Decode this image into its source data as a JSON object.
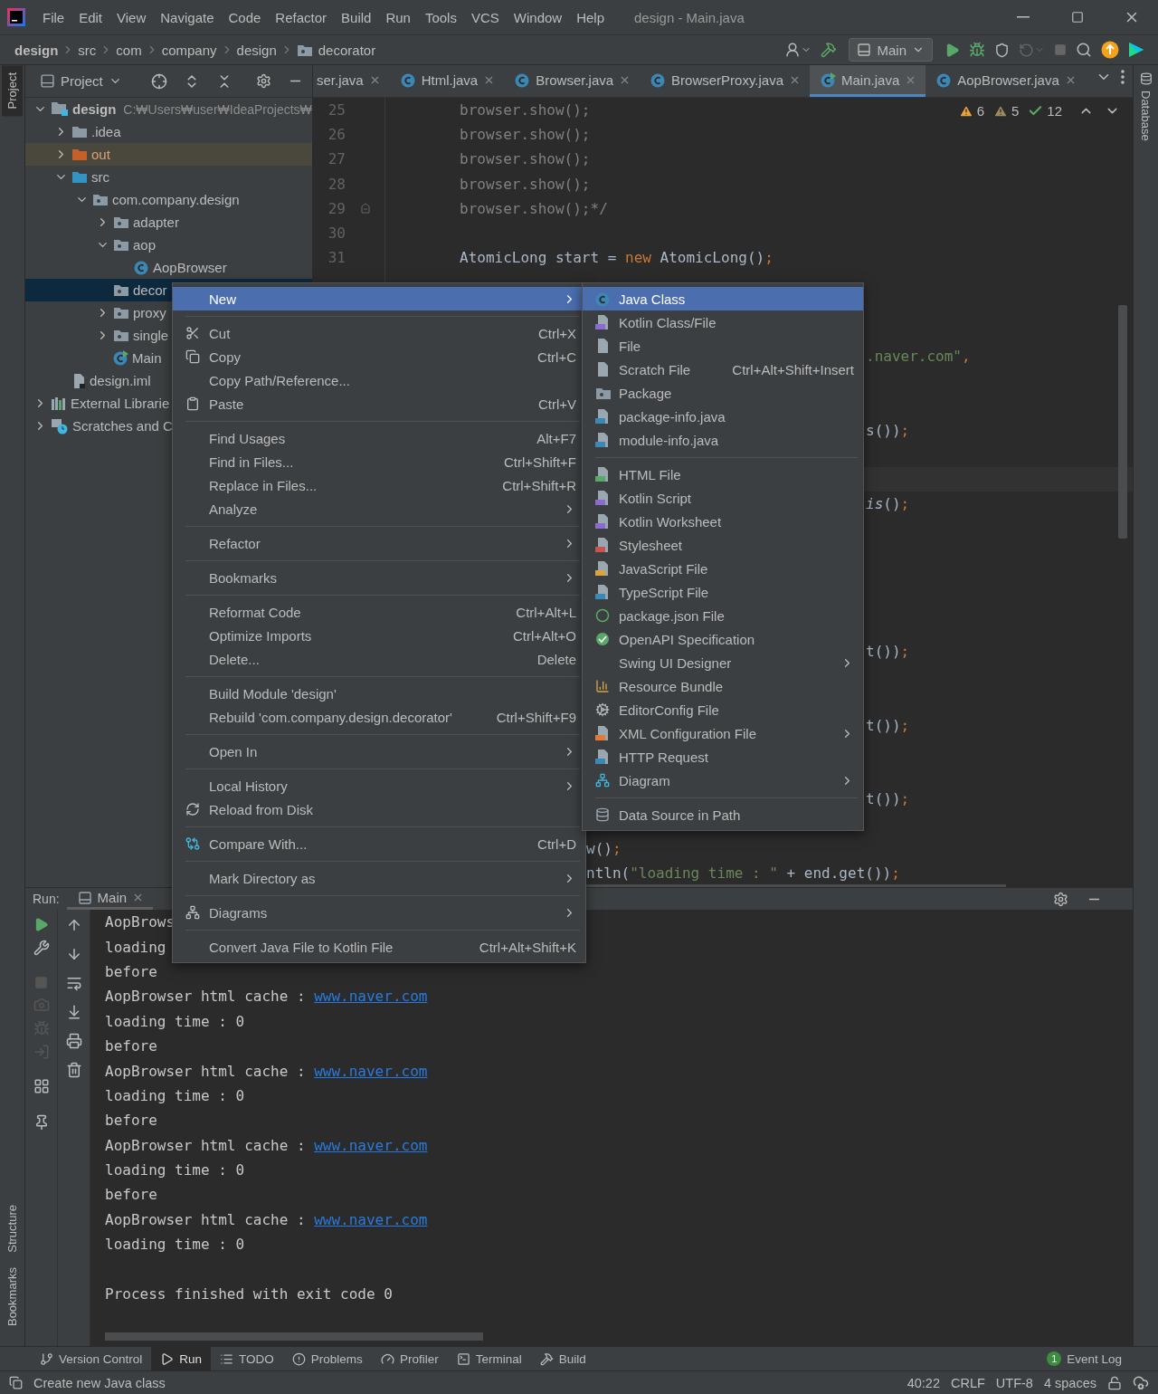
{
  "window": {
    "title": "design - Main.java",
    "menu": [
      "File",
      "Edit",
      "View",
      "Navigate",
      "Code",
      "Refactor",
      "Build",
      "Run",
      "Tools",
      "VCS",
      "Window",
      "Help"
    ]
  },
  "breadcrumbs": [
    "design",
    "src",
    "com",
    "company",
    "design",
    "decorator"
  ],
  "run_config": "Main",
  "left_strip": [
    {
      "label": "Project",
      "selected": true
    },
    {
      "label": "Structure",
      "selected": false
    },
    {
      "label": "Bookmarks",
      "selected": false
    }
  ],
  "right_strip": [
    {
      "label": "Database",
      "selected": false
    }
  ],
  "project_panel": {
    "title": "Project",
    "tree": [
      {
        "label": "design",
        "path": "C:₩Users₩user₩IdeaProjects₩",
        "kind": "module",
        "expanded": true,
        "selected": false,
        "children": [
          {
            "label": ".idea",
            "kind": "folder",
            "expanded": false,
            "selected": false
          },
          {
            "label": "out",
            "kind": "excluded",
            "expanded": false,
            "selected": false
          },
          {
            "label": "src",
            "kind": "source",
            "expanded": true,
            "selected": false,
            "children": [
              {
                "label": "com.company.design",
                "kind": "package",
                "expanded": true,
                "selected": false,
                "children": [
                  {
                    "label": "adapter",
                    "kind": "package",
                    "expanded": false,
                    "selected": false
                  },
                  {
                    "label": "aop",
                    "kind": "package",
                    "expanded": true,
                    "selected": false,
                    "children": [
                      {
                        "label": "AopBrowser",
                        "kind": "class",
                        "selected": false
                      }
                    ]
                  },
                  {
                    "label": "decor",
                    "kind": "package",
                    "selected": true
                  },
                  {
                    "label": "proxy",
                    "kind": "package",
                    "expanded": false,
                    "selected": false
                  },
                  {
                    "label": "single",
                    "kind": "package",
                    "expanded": false,
                    "selected": false
                  },
                  {
                    "label": "Main",
                    "kind": "main_class",
                    "selected": false
                  }
                ]
              }
            ]
          },
          {
            "label": "design.iml",
            "kind": "iml",
            "selected": false
          }
        ]
      },
      {
        "label": "External Librarie",
        "kind": "libraries",
        "expanded": false,
        "selected": false
      },
      {
        "label": "Scratches and C",
        "kind": "scratches",
        "expanded": false,
        "selected": false
      }
    ]
  },
  "tabs": [
    {
      "label": "ser.java",
      "kind": "partial",
      "selected": false
    },
    {
      "label": "Html.java",
      "kind": "class",
      "selected": false
    },
    {
      "label": "Browser.java",
      "kind": "class",
      "selected": false
    },
    {
      "label": "BrowserProxy.java",
      "kind": "class",
      "selected": false
    },
    {
      "label": "Main.java",
      "kind": "main_class",
      "selected": true
    },
    {
      "label": "AopBrowser.java",
      "kind": "class",
      "selected": false
    }
  ],
  "inspections": {
    "warnings": "6",
    "weak_warnings": "5",
    "typos": "12"
  },
  "code_lines": [
    {
      "number": "25",
      "tokens": [
        {
          "kind": "comment",
          "text": "browser.show();"
        }
      ]
    },
    {
      "number": "26",
      "tokens": [
        {
          "kind": "comment",
          "text": "browser.show();"
        }
      ]
    },
    {
      "number": "27",
      "tokens": [
        {
          "kind": "comment",
          "text": "browser.show();"
        }
      ]
    },
    {
      "number": "28",
      "tokens": [
        {
          "kind": "comment",
          "text": "browser.show();"
        }
      ]
    },
    {
      "number": "29",
      "tokens": [
        {
          "kind": "comment",
          "text": "browser.show();*/"
        }
      ]
    },
    {
      "number": "30"
    },
    {
      "number": "31",
      "tokens": [
        {
          "kind": "plain",
          "text": "AtomicLong start = "
        },
        {
          "kind": "keyword",
          "text": "new"
        },
        {
          "kind": "plain",
          "text": " AtomicLong()"
        },
        {
          "kind": "punct",
          "text": ";"
        }
      ]
    }
  ],
  "code_fragments": [
    {
      "tokens": [
        {
          "kind": "string",
          "text": ".naver.com\""
        },
        {
          "kind": "punct",
          "text": ","
        }
      ]
    },
    {
      "tokens": [
        {
          "kind": "plain",
          "text": "s())"
        },
        {
          "kind": "punct",
          "text": ";"
        }
      ]
    },
    {
      "tokens": [
        {
          "kind": "italic",
          "text": "is"
        },
        {
          "kind": "plain",
          "text": "()"
        },
        {
          "kind": "punct",
          "text": ";"
        }
      ]
    },
    {
      "tokens": [
        {
          "kind": "plain",
          "text": "t())"
        },
        {
          "kind": "punct",
          "text": ";"
        }
      ]
    },
    {
      "tokens": [
        {
          "kind": "plain",
          "text": "t())"
        },
        {
          "kind": "punct",
          "text": ";"
        }
      ]
    },
    {
      "tokens": [
        {
          "kind": "plain",
          "text": "t())"
        },
        {
          "kind": "punct",
          "text": ";"
        }
      ]
    },
    {
      "tokens": [
        {
          "kind": "plain",
          "text": "w()"
        },
        {
          "kind": "punct",
          "text": ";"
        }
      ]
    },
    {
      "tokens": [
        {
          "kind": "plain",
          "text": "ntln("
        },
        {
          "kind": "string",
          "text": "\"loading time : \""
        },
        {
          "kind": "plain",
          "text": " + end.get())"
        },
        {
          "kind": "punct",
          "text": ";"
        }
      ]
    }
  ],
  "context_menu": [
    {
      "kind": "item",
      "label": "New",
      "submenu": true,
      "selected": true
    },
    {
      "kind": "separator"
    },
    {
      "kind": "item",
      "label": "Cut",
      "shortcut": "Ctrl+X",
      "submenu": false,
      "selected": false
    },
    {
      "kind": "item",
      "label": "Copy",
      "shortcut": "Ctrl+C",
      "submenu": false,
      "selected": false
    },
    {
      "kind": "item",
      "label": "Copy Path/Reference...",
      "submenu": false,
      "selected": false
    },
    {
      "kind": "item",
      "label": "Paste",
      "shortcut": "Ctrl+V",
      "submenu": false,
      "selected": false
    },
    {
      "kind": "separator"
    },
    {
      "kind": "item",
      "label": "Find Usages",
      "shortcut": "Alt+F7",
      "submenu": false,
      "selected": false
    },
    {
      "kind": "item",
      "label": "Find in Files...",
      "shortcut": "Ctrl+Shift+F",
      "submenu": false,
      "selected": false
    },
    {
      "kind": "item",
      "label": "Replace in Files...",
      "shortcut": "Ctrl+Shift+R",
      "submenu": false,
      "selected": false
    },
    {
      "kind": "item",
      "label": "Analyze",
      "submenu": true,
      "selected": false
    },
    {
      "kind": "separator"
    },
    {
      "kind": "item",
      "label": "Refactor",
      "submenu": true,
      "selected": false
    },
    {
      "kind": "separator"
    },
    {
      "kind": "item",
      "label": "Bookmarks",
      "submenu": true,
      "selected": false
    },
    {
      "kind": "separator"
    },
    {
      "kind": "item",
      "label": "Reformat Code",
      "shortcut": "Ctrl+Alt+L",
      "submenu": false,
      "selected": false
    },
    {
      "kind": "item",
      "label": "Optimize Imports",
      "shortcut": "Ctrl+Alt+O",
      "submenu": false,
      "selected": false
    },
    {
      "kind": "item",
      "label": "Delete...",
      "shortcut": "Delete",
      "submenu": false,
      "selected": false
    },
    {
      "kind": "separator"
    },
    {
      "kind": "item",
      "label": "Build Module 'design'",
      "submenu": false,
      "selected": false
    },
    {
      "kind": "item",
      "label": "Rebuild 'com.company.design.decorator'",
      "shortcut": "Ctrl+Shift+F9",
      "submenu": false,
      "selected": false
    },
    {
      "kind": "separator"
    },
    {
      "kind": "item",
      "label": "Open In",
      "submenu": true,
      "selected": false
    },
    {
      "kind": "separator"
    },
    {
      "kind": "item",
      "label": "Local History",
      "submenu": true,
      "selected": false
    },
    {
      "kind": "item",
      "label": "Reload from Disk",
      "submenu": false,
      "selected": false
    },
    {
      "kind": "separator"
    },
    {
      "kind": "item",
      "label": "Compare With...",
      "shortcut": "Ctrl+D",
      "submenu": false,
      "selected": false
    },
    {
      "kind": "separator"
    },
    {
      "kind": "item",
      "label": "Mark Directory as",
      "submenu": true,
      "selected": false
    },
    {
      "kind": "separator"
    },
    {
      "kind": "item",
      "label": "Diagrams",
      "submenu": true,
      "selected": false
    },
    {
      "kind": "separator"
    },
    {
      "kind": "item",
      "label": "Convert Java File to Kotlin File",
      "shortcut": "Ctrl+Alt+Shift+K",
      "submenu": false,
      "selected": false
    }
  ],
  "new_submenu": [
    {
      "kind": "item",
      "label": "Java Class",
      "submenu": false,
      "selected": true
    },
    {
      "kind": "item",
      "label": "Kotlin Class/File",
      "submenu": false,
      "selected": false
    },
    {
      "kind": "item",
      "label": "File",
      "submenu": false,
      "selected": false
    },
    {
      "kind": "item",
      "label": "Scratch File",
      "shortcut": "Ctrl+Alt+Shift+Insert",
      "submenu": false,
      "selected": false
    },
    {
      "kind": "item",
      "label": "Package",
      "submenu": false,
      "selected": false
    },
    {
      "kind": "item",
      "label": "package-info.java",
      "submenu": false,
      "selected": false
    },
    {
      "kind": "item",
      "label": "module-info.java",
      "submenu": false,
      "selected": false
    },
    {
      "kind": "separator"
    },
    {
      "kind": "item",
      "label": "HTML File",
      "submenu": false,
      "selected": false
    },
    {
      "kind": "item",
      "label": "Kotlin Script",
      "submenu": false,
      "selected": false
    },
    {
      "kind": "item",
      "label": "Kotlin Worksheet",
      "submenu": false,
      "selected": false
    },
    {
      "kind": "item",
      "label": "Stylesheet",
      "submenu": false,
      "selected": false
    },
    {
      "kind": "item",
      "label": "JavaScript File",
      "submenu": false,
      "selected": false
    },
    {
      "kind": "item",
      "label": "TypeScript File",
      "submenu": false,
      "selected": false
    },
    {
      "kind": "item",
      "label": "package.json File",
      "submenu": false,
      "selected": false
    },
    {
      "kind": "item",
      "label": "OpenAPI Specification",
      "submenu": false,
      "selected": false
    },
    {
      "kind": "item",
      "label": "Swing UI Designer",
      "submenu": true,
      "selected": false
    },
    {
      "kind": "item",
      "label": "Resource Bundle",
      "submenu": false,
      "selected": false
    },
    {
      "kind": "item",
      "label": "EditorConfig File",
      "submenu": false,
      "selected": false
    },
    {
      "kind": "item",
      "label": "XML Configuration File",
      "submenu": true,
      "selected": false
    },
    {
      "kind": "item",
      "label": "HTTP Request",
      "submenu": false,
      "selected": false
    },
    {
      "kind": "item",
      "label": "Diagram",
      "submenu": true,
      "selected": false
    },
    {
      "kind": "separator"
    },
    {
      "kind": "item",
      "label": "Data Source in Path",
      "submenu": false,
      "selected": false
    }
  ],
  "run_panel": {
    "label": "Run:",
    "tab": "Main",
    "console": [
      {
        "kind": "output",
        "text": "AopBrows"
      },
      {
        "kind": "output",
        "text": "loading"
      },
      {
        "kind": "output",
        "text": "before"
      },
      {
        "kind": "output",
        "text": "AopBrowser html cache : ",
        "link": "www.naver.com"
      },
      {
        "kind": "output",
        "text": "loading time : 0"
      },
      {
        "kind": "output",
        "text": "before"
      },
      {
        "kind": "output",
        "text": "AopBrowser html cache : ",
        "link": "www.naver.com"
      },
      {
        "kind": "output",
        "text": "loading time : 0"
      },
      {
        "kind": "output",
        "text": "before"
      },
      {
        "kind": "output",
        "text": "AopBrowser html cache : ",
        "link": "www.naver.com"
      },
      {
        "kind": "output",
        "text": "loading time : 0"
      },
      {
        "kind": "output",
        "text": "before"
      },
      {
        "kind": "output",
        "text": "AopBrowser html cache : ",
        "link": "www.naver.com"
      },
      {
        "kind": "output",
        "text": "loading time : 0"
      },
      {
        "kind": "exit",
        "text": "Process finished with exit code 0"
      }
    ]
  },
  "tool_tabs": [
    {
      "label": "Version Control",
      "selected": false
    },
    {
      "label": "Run",
      "selected": true
    },
    {
      "label": "TODO",
      "selected": false
    },
    {
      "label": "Problems",
      "selected": false
    },
    {
      "label": "Profiler",
      "selected": false
    },
    {
      "label": "Terminal",
      "selected": false
    },
    {
      "label": "Build",
      "selected": false
    }
  ],
  "event_log": {
    "label": "Event Log",
    "count": "1"
  },
  "status_bar": {
    "message": "Create new Java class",
    "position": "40:22",
    "line_ending": "CRLF",
    "encoding": "UTF-8",
    "indent": "4 spaces"
  }
}
